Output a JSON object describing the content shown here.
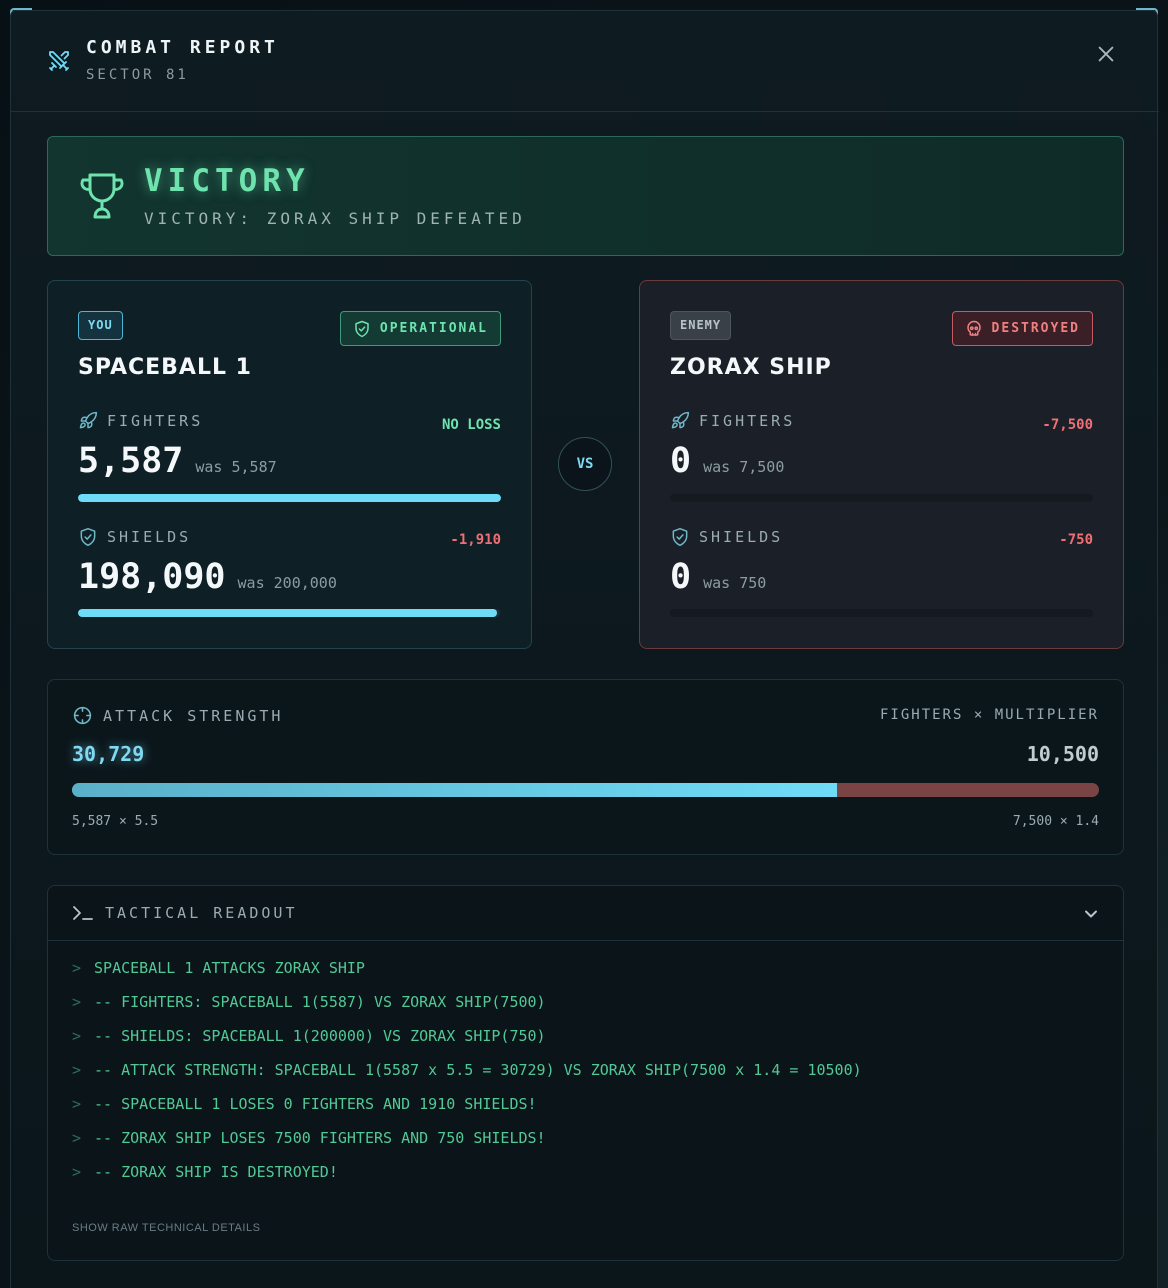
{
  "header": {
    "title": "COMBAT REPORT",
    "subtitle": "SECTOR 81",
    "icon": "crossed-swords-icon",
    "close_icon": "close-icon"
  },
  "result": {
    "title": "VICTORY",
    "subtitle": "VICTORY: ZORAX SHIP DEFEATED",
    "icon": "trophy-icon",
    "color": "#6ee3ae"
  },
  "player": {
    "tag": "YOU",
    "status": "OPERATIONAL",
    "name": "SPACEBALL 1",
    "fighters": {
      "label": "FIGHTERS",
      "value": "5,587",
      "was": "was 5,587",
      "delta": "NO LOSS",
      "fraction": 1.0
    },
    "shields": {
      "label": "SHIELDS",
      "value": "198,090",
      "was": "was 200,000",
      "delta": "-1,910",
      "fraction": 0.99
    }
  },
  "vs_label": "VS",
  "enemy": {
    "tag": "ENEMY",
    "status": "DESTROYED",
    "name": "ZORAX SHIP",
    "fighters": {
      "label": "FIGHTERS",
      "value": "0",
      "was": "was 7,500",
      "delta": "-7,500",
      "fraction": 0
    },
    "shields": {
      "label": "SHIELDS",
      "value": "0",
      "was": "was 750",
      "delta": "-750",
      "fraction": 0
    }
  },
  "attack": {
    "label": "ATTACK STRENGTH",
    "formula": "FIGHTERS × MULTIPLIER",
    "you_value": "30,729",
    "enemy_value": "10,500",
    "you_calc": "5,587 × 5.5",
    "enemy_calc": "7,500 × 1.4",
    "you_share": 0.745
  },
  "readout": {
    "title": "TACTICAL READOUT",
    "caret": ">",
    "lines": [
      "SPACEBALL 1 ATTACKS ZORAX SHIP",
      "-- FIGHTERS: SPACEBALL 1(5587) VS ZORAX SHIP(7500)",
      "-- SHIELDS: SPACEBALL 1(200000) VS ZORAX SHIP(750)",
      "-- ATTACK STRENGTH: SPACEBALL 1(5587 x 5.5 = 30729) VS ZORAX SHIP(7500 x 1.4 = 10500)",
      "-- SPACEBALL 1 LOSES 0 FIGHTERS AND 1910 SHIELDS!",
      "-- ZORAX SHIP LOSES 7500 FIGHTERS AND 750 SHIELDS!",
      "-- ZORAX SHIP IS DESTROYED!"
    ],
    "raw_link": "SHOW RAW TECHNICAL DETAILS"
  }
}
